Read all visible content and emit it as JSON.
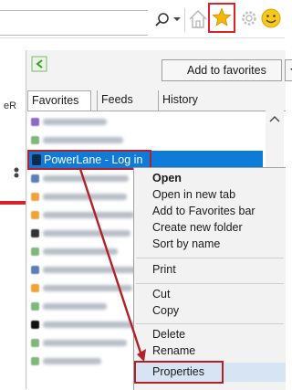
{
  "panel": {
    "add_favorites_label": "Add to favorites",
    "tabs": [
      {
        "label": "Favorites"
      },
      {
        "label": "Feeds"
      },
      {
        "label": "History"
      }
    ],
    "selected_item_label": "PowerLane - Log in",
    "left_page_text": "eR"
  },
  "context_menu": {
    "items": [
      {
        "label": "Open"
      },
      {
        "label": "Open in new tab"
      },
      {
        "label": "Add to Favorites bar"
      },
      {
        "label": "Create new folder"
      },
      {
        "label": "Sort by name"
      },
      {
        "label": "Print"
      },
      {
        "label": "Cut"
      },
      {
        "label": "Copy"
      },
      {
        "label": "Delete"
      },
      {
        "label": "Rename"
      },
      {
        "label": "Properties"
      }
    ]
  },
  "colors": {
    "annotation_red": "#b2202a",
    "selection_blue": "#0f7bd8",
    "star_gold": "#f2b705"
  }
}
